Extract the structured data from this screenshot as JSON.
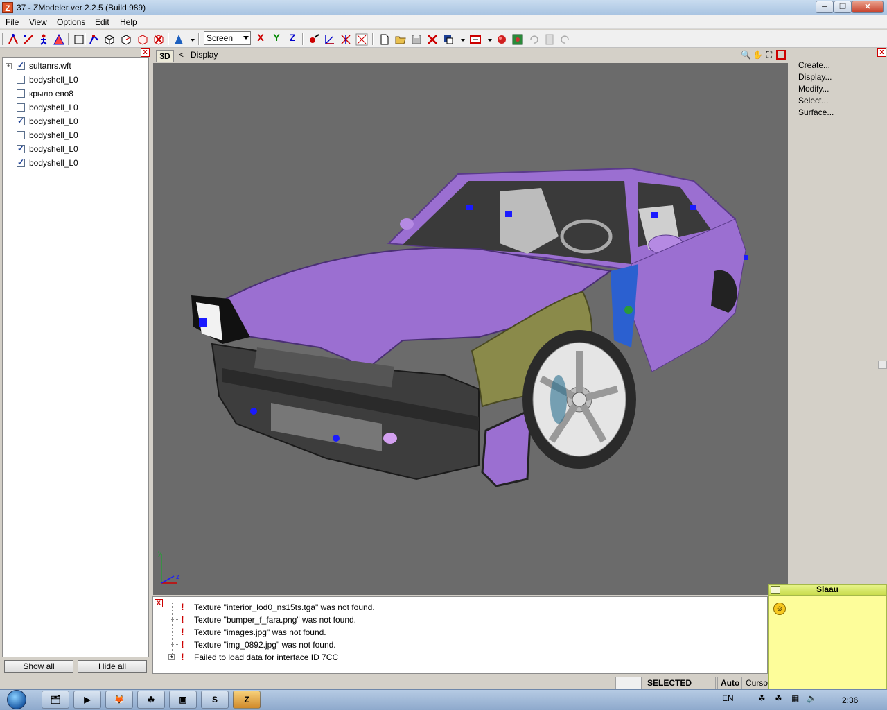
{
  "window": {
    "title": "37 - ZModeler ver 2.2.5 (Build 989)",
    "app_icon": "Z",
    "min_label": "─",
    "max_label": "❐",
    "close_label": "✕"
  },
  "menu": [
    {
      "label": "File"
    },
    {
      "label": "View"
    },
    {
      "label": "Options"
    },
    {
      "label": "Edit"
    },
    {
      "label": "Help"
    }
  ],
  "toolbar": {
    "view_select_value": "Screen",
    "axis_x": "X",
    "axis_y": "Y",
    "axis_z": "Z"
  },
  "scene_tree": {
    "items": [
      {
        "label": "sultanrs.wft",
        "checked": true,
        "expandable": true
      },
      {
        "label": "bodyshell_L0",
        "checked": false
      },
      {
        "label": "крыло ево8",
        "checked": false
      },
      {
        "label": "bodyshell_L0",
        "checked": false
      },
      {
        "label": "bodyshell_L0",
        "checked": true
      },
      {
        "label": "bodyshell_L0",
        "checked": false
      },
      {
        "label": "bodyshell_L0",
        "checked": true
      },
      {
        "label": "bodyshell_L0",
        "checked": true
      }
    ],
    "show_all_label": "Show all",
    "hide_all_label": "Hide all"
  },
  "viewport": {
    "mode_label": "3D",
    "nav_label": "<",
    "title": "Display",
    "axis_y": "y",
    "axis_z": "z",
    "background_color": "#6b6b6b",
    "car_color": "#9b6fd1"
  },
  "command_panel": {
    "items": [
      "Create...",
      "Display...",
      "Modify...",
      "Select...",
      "Surface..."
    ]
  },
  "log": {
    "entries": [
      {
        "text": "Texture \"interior_lod0_ns15ts.tga\" was not found."
      },
      {
        "text": "Texture \"bumper_f_fara.png\" was not found."
      },
      {
        "text": "Texture \"images.jpg\" was not found."
      },
      {
        "text": "Texture \"img_0892.jpg\" was not found."
      },
      {
        "text": "Failed to load data for interface ID 7CC",
        "expandable": true
      }
    ]
  },
  "status": {
    "mode": "SELECTED MODE",
    "auto": "Auto",
    "cursor": "Cursor"
  },
  "chat_popup": {
    "name": "Slaau"
  },
  "taskbar": {
    "language": "EN",
    "time": "2:36"
  }
}
